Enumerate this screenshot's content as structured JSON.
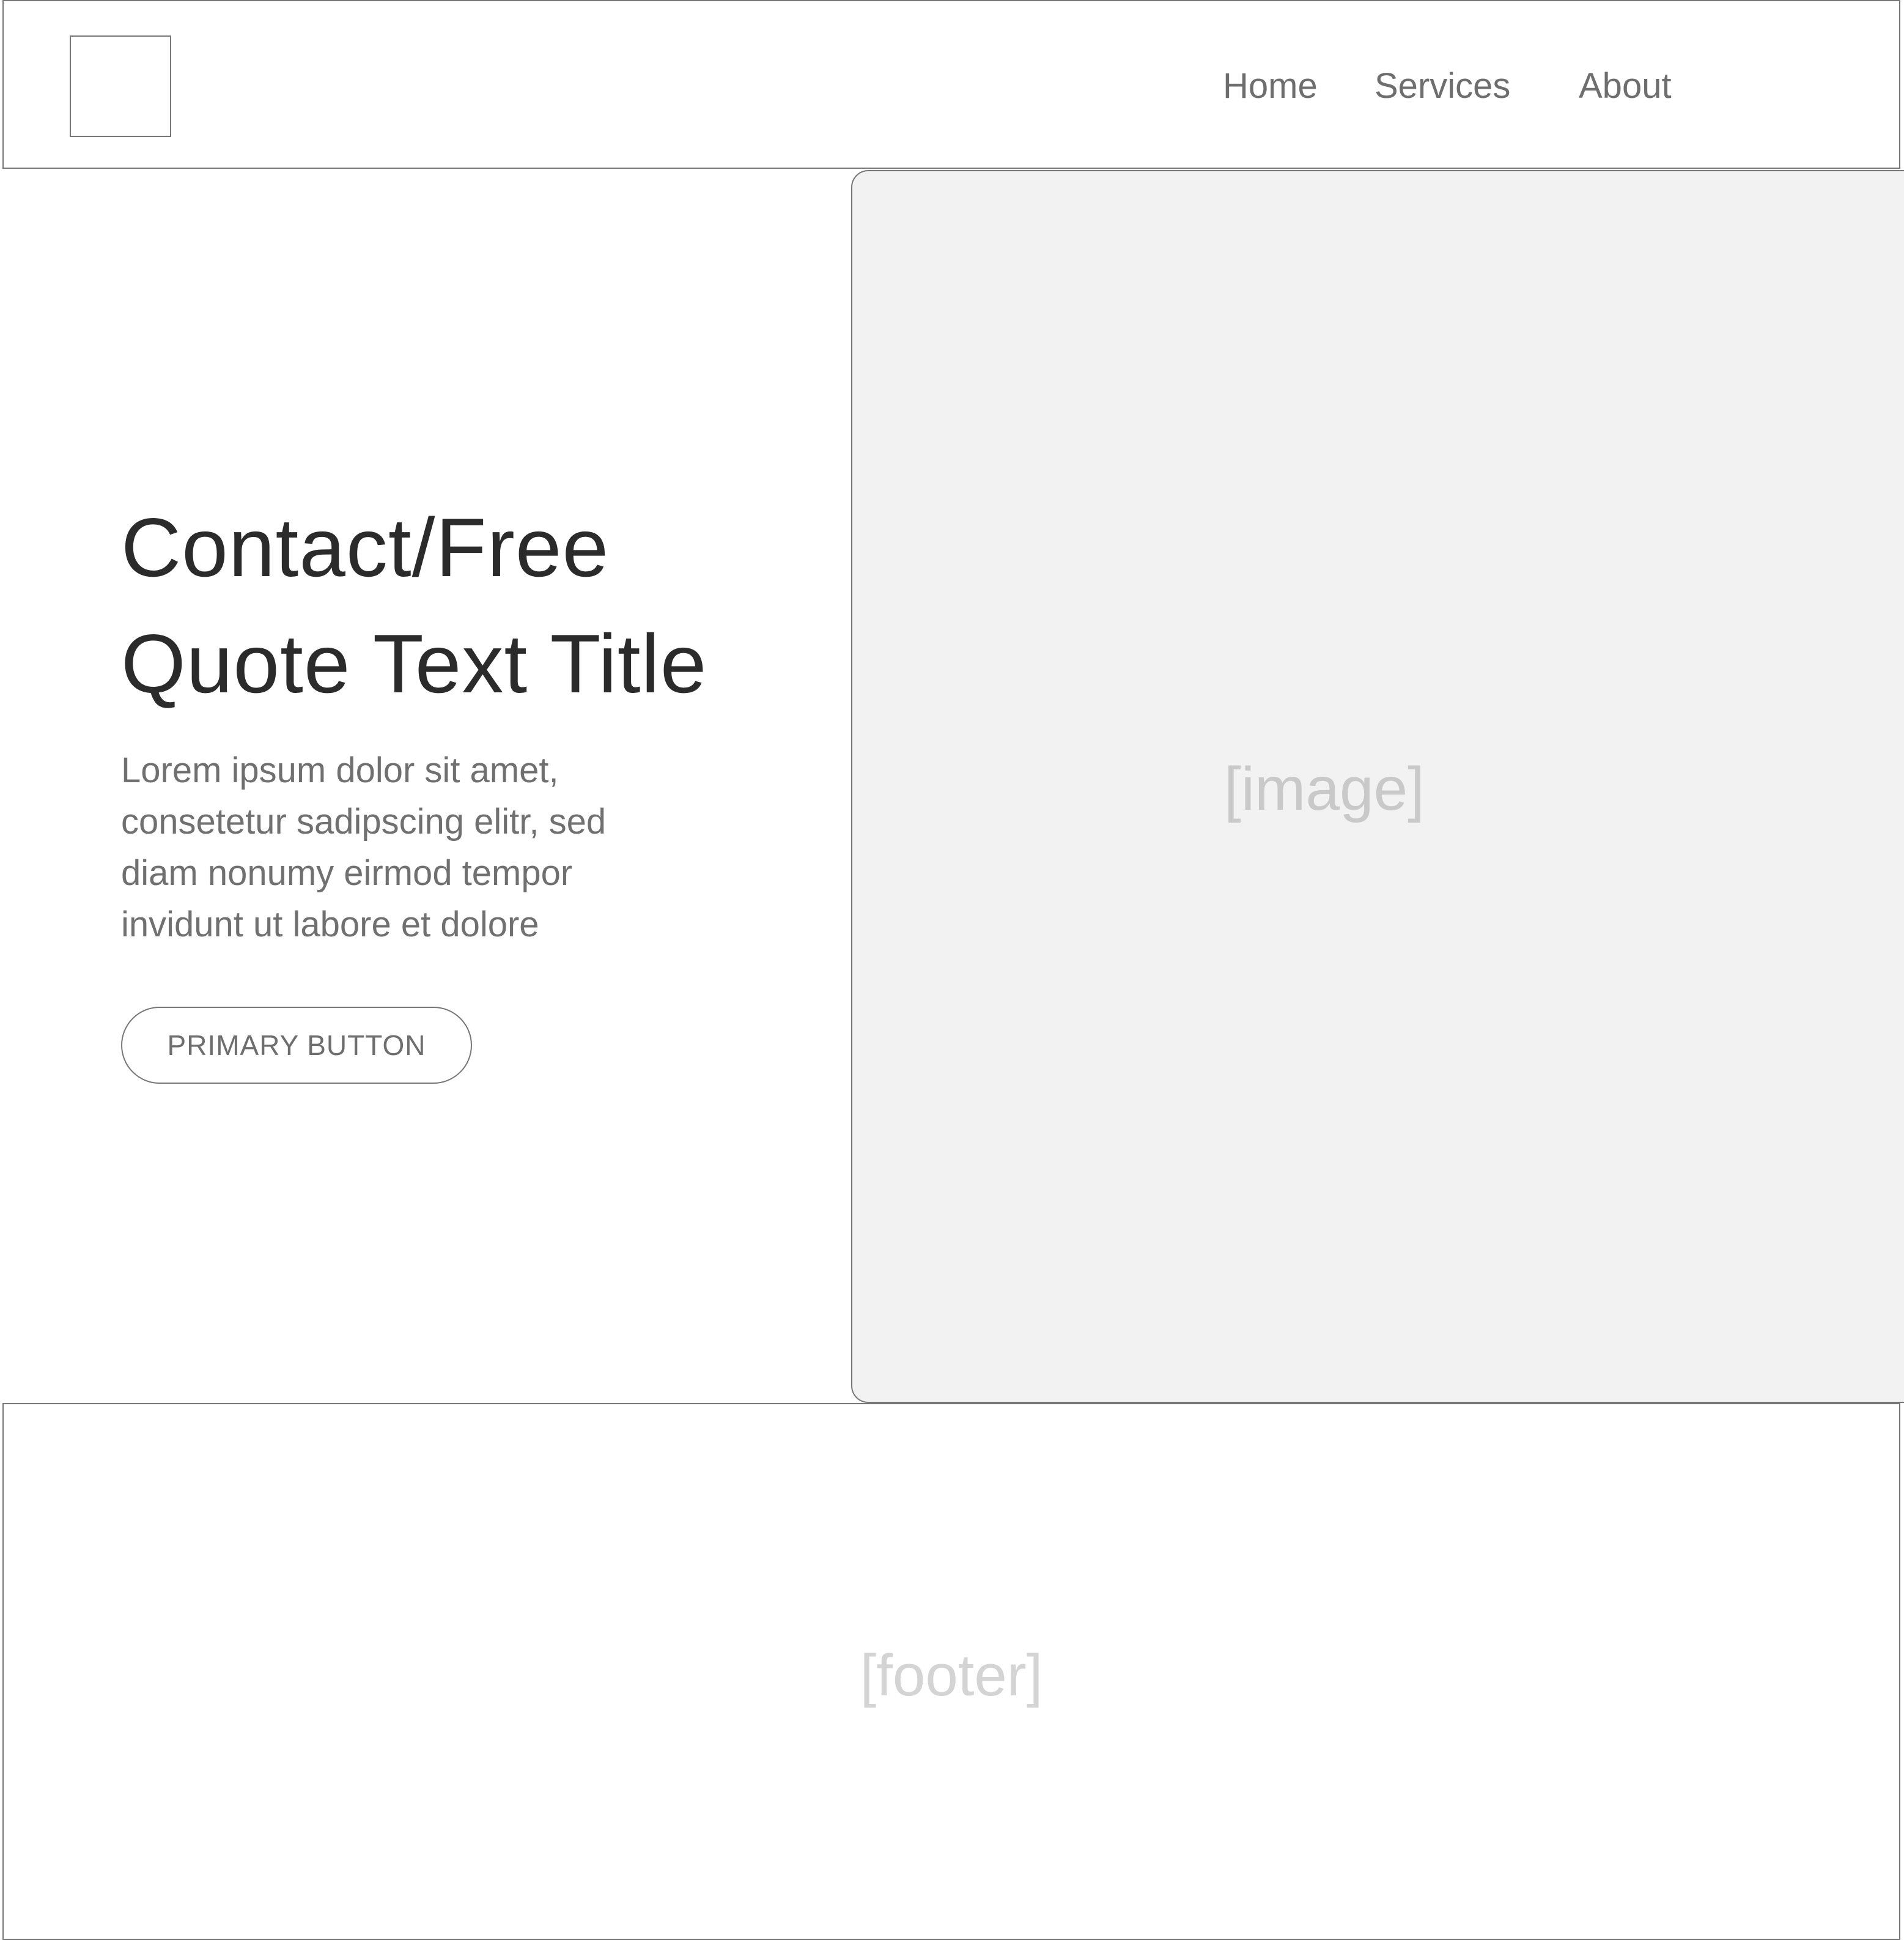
{
  "header": {
    "nav": {
      "home": "Home",
      "services": "Services",
      "about": "About"
    }
  },
  "hero": {
    "title_lines": [
      "Contact/Free",
      "Quote Text Title"
    ],
    "text_lines": [
      "Lorem ipsum dolor sit amet,",
      "consetetur sadipscing elitr, sed",
      "diam nonumy eirmod tempor",
      "invidunt ut labore et dolore"
    ],
    "button_label": "PRIMARY BUTTON"
  },
  "image": {
    "label": "[image]"
  },
  "footer": {
    "label": "[footer]"
  }
}
